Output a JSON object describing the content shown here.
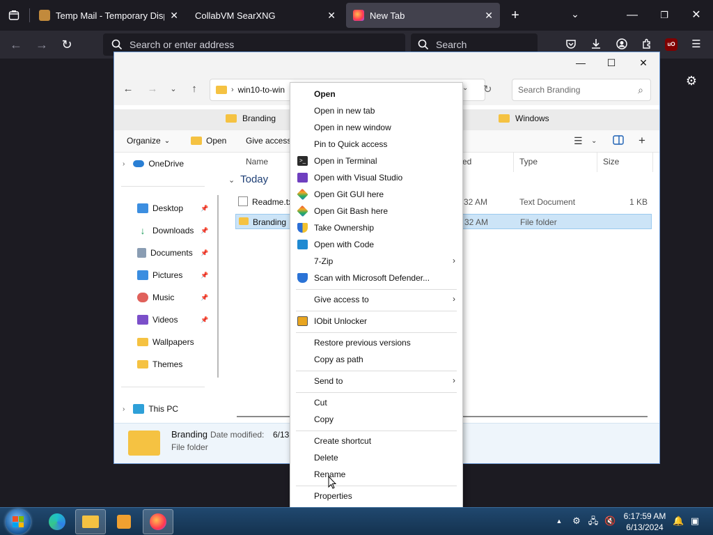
{
  "firefox": {
    "tabs": [
      {
        "title": "Temp Mail - Temporary Dispos",
        "close": "✕"
      },
      {
        "title": "CollabVM SearXNG",
        "close": "✕"
      },
      {
        "title": "New Tab",
        "close": "✕"
      }
    ],
    "new_tab_symbol": "+",
    "url_placeholder": "Search or enter address",
    "search_placeholder": "Search",
    "ublock_label": "uO"
  },
  "explorer": {
    "address_path": "win10-to-win",
    "search_placeholder": "Search Branding",
    "folder_tabs": [
      "Branding",
      "Windows"
    ],
    "toolbar": {
      "organize": "Organize",
      "open": "Open",
      "give_access": "Give access"
    },
    "nav_pane": {
      "onedrive": "OneDrive",
      "quick": [
        "Desktop",
        "Downloads",
        "Documents",
        "Pictures",
        "Music",
        "Videos",
        "Wallpapers",
        "Themes"
      ],
      "this_pc": "This PC"
    },
    "columns": {
      "name": "Name",
      "date": "ed",
      "type": "Type",
      "size": "Size"
    },
    "group": "Today",
    "files": [
      {
        "name": "Readme.txt",
        "date": "32 AM",
        "type": "Text Document",
        "size": "1 KB",
        "selected": false
      },
      {
        "name": "Branding",
        "date": "32 AM",
        "type": "File folder",
        "size": "",
        "selected": true
      }
    ],
    "details": {
      "name": "Branding",
      "date_label": "Date modified:",
      "date_value": "6/13,",
      "type": "File folder"
    }
  },
  "context_menu": {
    "items": [
      "Open",
      "Open in new tab",
      "Open in new window",
      "Pin to Quick access",
      "Open in Terminal",
      "Open with Visual Studio",
      "Open Git GUI here",
      "Open Git Bash here",
      "Take Ownership",
      "Open with Code",
      "7-Zip",
      "Scan with Microsoft Defender...",
      "Give access to",
      "IObit Unlocker",
      "Restore previous versions",
      "Copy as path",
      "Send to",
      "Cut",
      "Copy",
      "Create shortcut",
      "Delete",
      "Rename",
      "Properties"
    ],
    "submenu_arrow": "›"
  },
  "taskbar": {
    "time": "6:17:59 AM",
    "date": "6/13/2024"
  },
  "colors": {
    "firefox_bg": "#1c1b22",
    "firefox_toolbar": "#2b2a33",
    "selection": "#cce4f7",
    "folder": "#f5c242",
    "taskbar": "#1b3d60"
  }
}
